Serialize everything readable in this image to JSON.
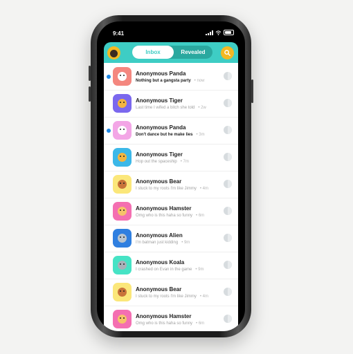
{
  "status_bar": {
    "time": "9:41"
  },
  "header": {
    "tabs": [
      {
        "label": "Inbox",
        "active": true
      },
      {
        "label": "Revealed",
        "active": false
      }
    ],
    "accent_color": "#3ecdc4",
    "button_color": "#f3b823",
    "search_icon": "search-icon"
  },
  "messages": [
    {
      "name": "Anonymous Panda",
      "preview": "Nothing but a gangsta party",
      "ago": "now",
      "unread": true,
      "animal": "panda",
      "tile_color": "#f4877f"
    },
    {
      "name": "Anonymous Tiger",
      "preview": "Last time I wifed a bitch she told",
      "ago": "2w",
      "unread": false,
      "animal": "tiger",
      "tile_color": "#7b68ee"
    },
    {
      "name": "Anonymous Panda",
      "preview": "Don't dance but he make lies",
      "ago": "3m",
      "unread": true,
      "animal": "panda",
      "tile_color": "#f3a6e6"
    },
    {
      "name": "Anonymous Tiger",
      "preview": "Hop out the spaceship",
      "ago": "7m",
      "unread": false,
      "animal": "tiger",
      "tile_color": "#3cb8e8"
    },
    {
      "name": "Anonymous Bear",
      "preview": "I stuck to my roots I'm like Jimmy",
      "ago": "4m",
      "unread": false,
      "animal": "bear",
      "tile_color": "#fbe77a"
    },
    {
      "name": "Anonymous Hamster",
      "preview": "Omg who is this haha so funny",
      "ago": "6m",
      "unread": false,
      "animal": "hamster",
      "tile_color": "#f46fb1"
    },
    {
      "name": "Anonymous Alien",
      "preview": "I'm batman just kidding",
      "ago": "9m",
      "unread": false,
      "animal": "alien",
      "tile_color": "#2f7fe0"
    },
    {
      "name": "Anonymous Koala",
      "preview": "I crashed on Evan in the game",
      "ago": "9m",
      "unread": false,
      "animal": "koala",
      "tile_color": "#46e3c5"
    },
    {
      "name": "Anonymous Bear",
      "preview": "I stuck to my roots I'm like Jimmy",
      "ago": "4m",
      "unread": false,
      "animal": "bear",
      "tile_color": "#fbe77a"
    },
    {
      "name": "Anonymous Hamster",
      "preview": "Omg who is this haha so funny",
      "ago": "6m",
      "unread": false,
      "animal": "hamster",
      "tile_color": "#f46fb1"
    }
  ]
}
